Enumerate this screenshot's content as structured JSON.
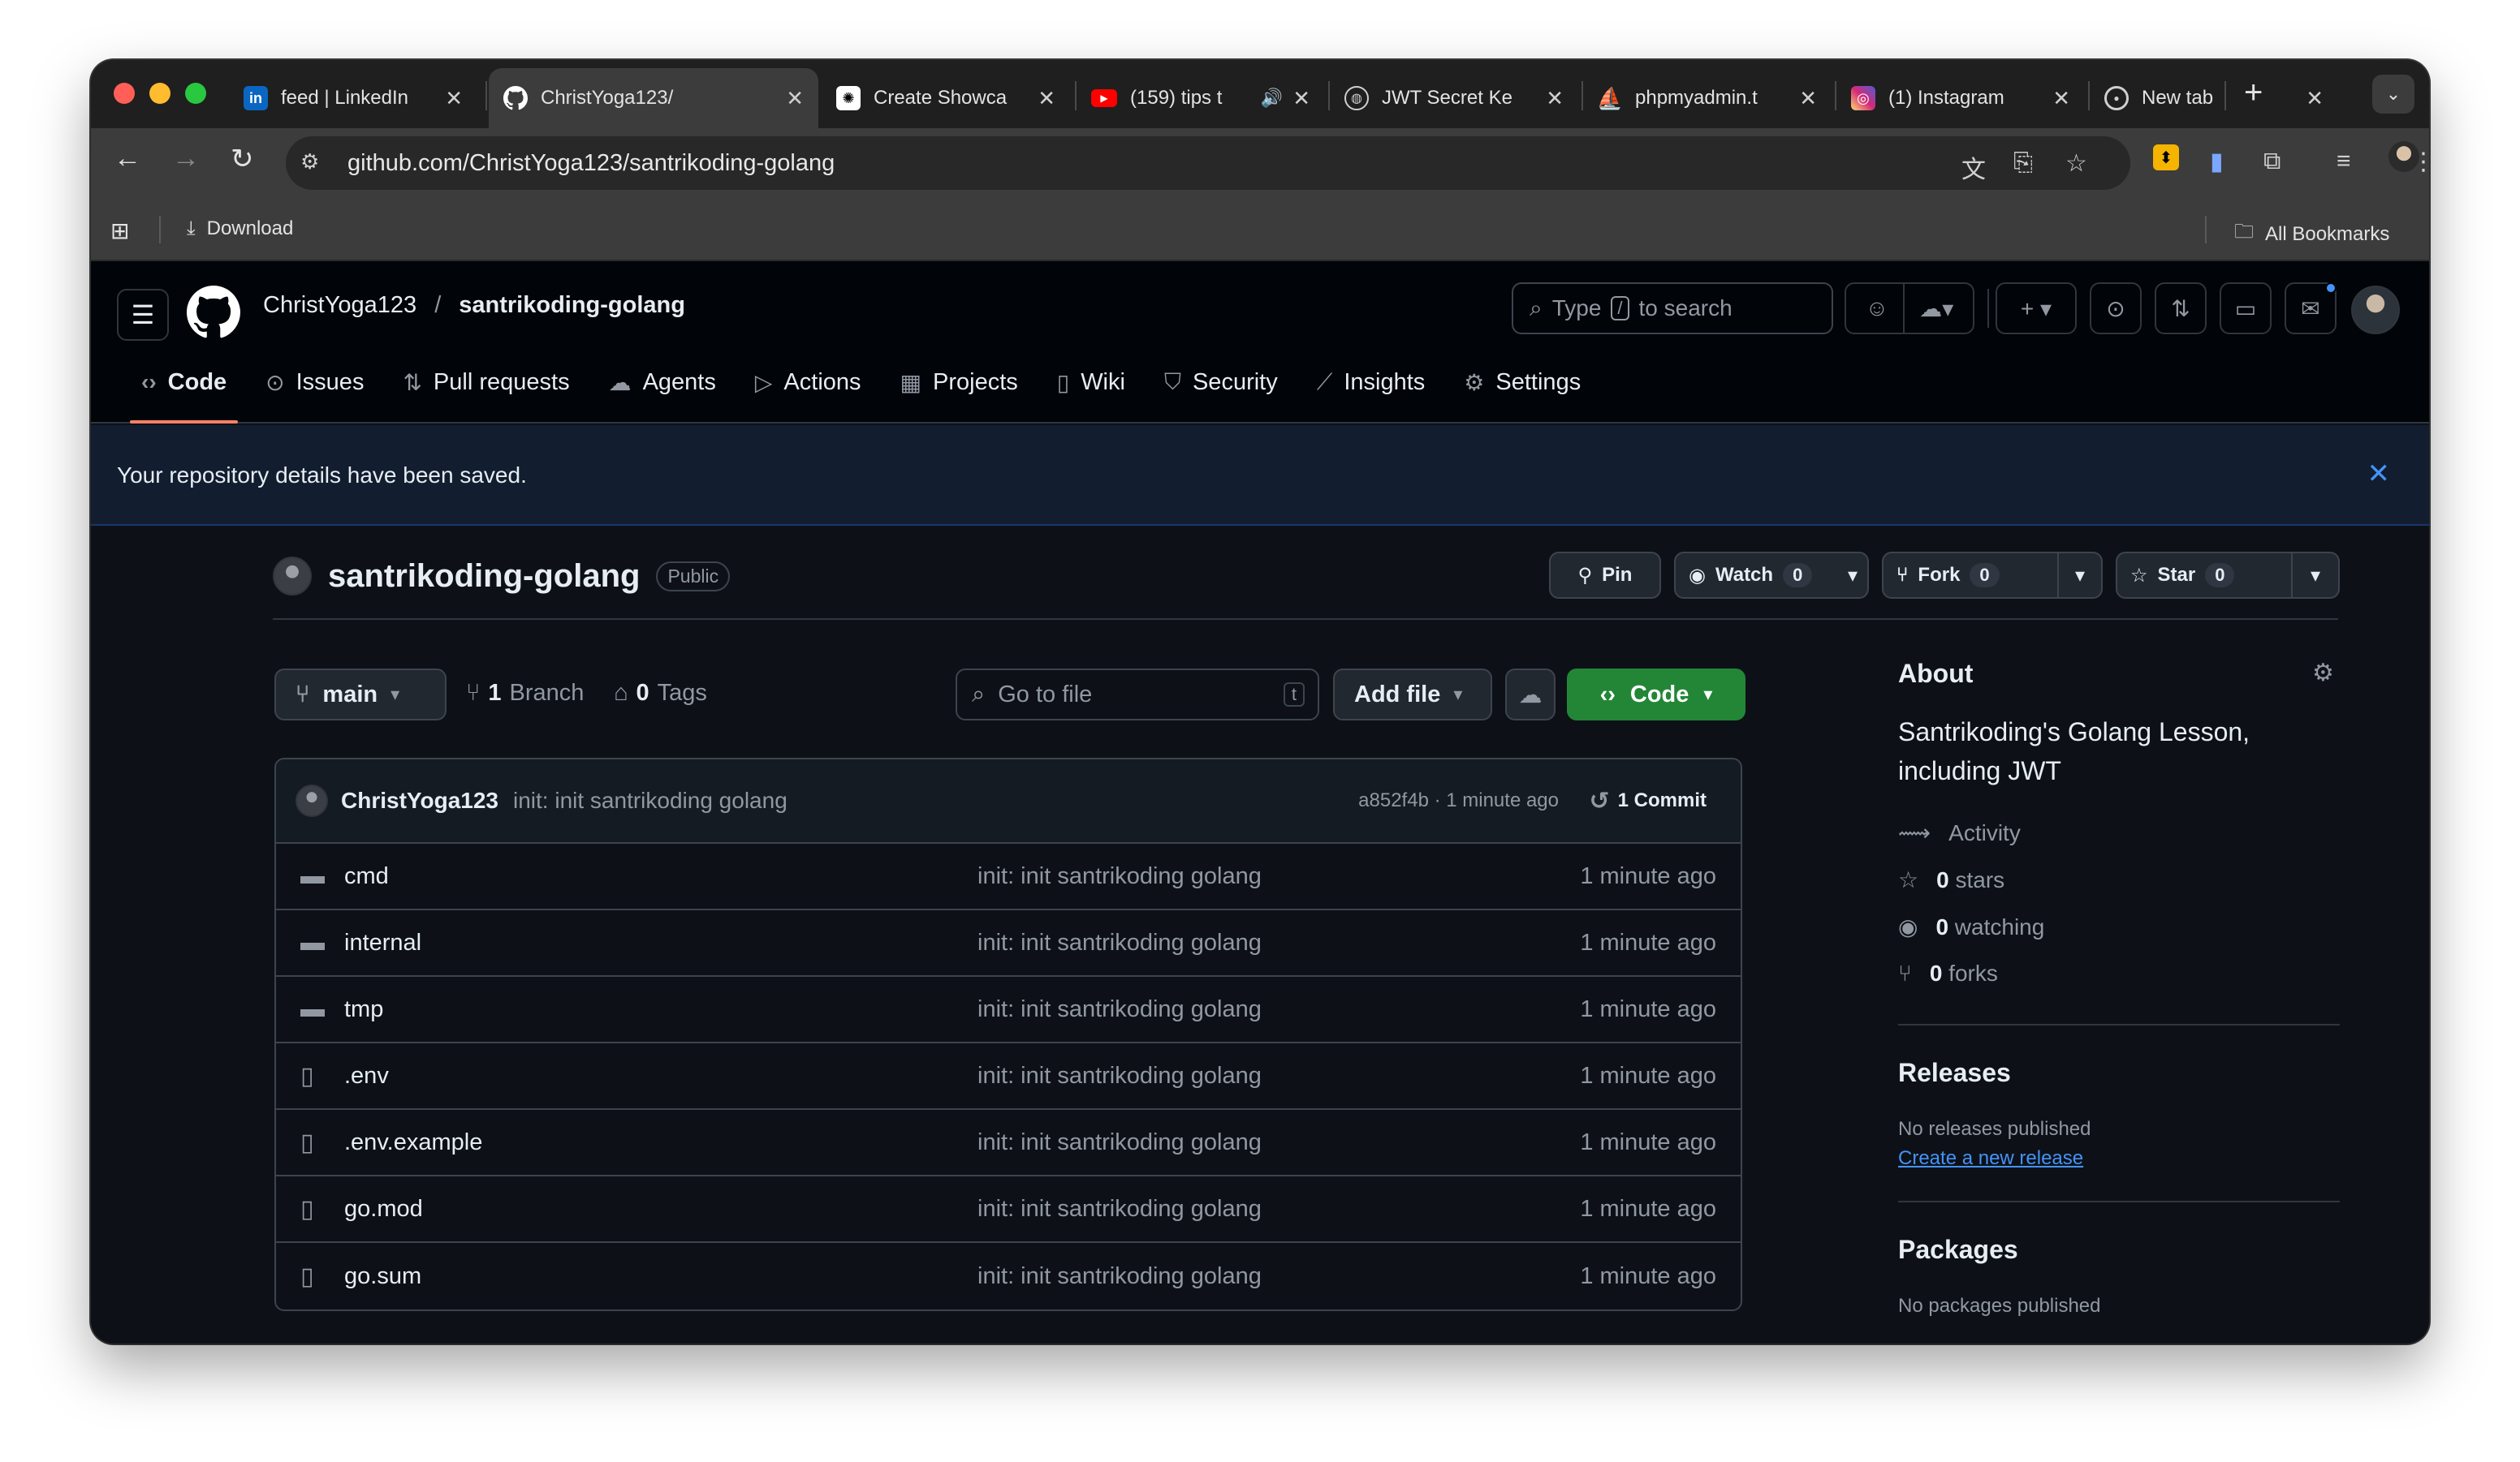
{
  "browser": {
    "tabs": [
      {
        "title": "feed | LinkedIn",
        "icon": "linkedin-icon",
        "active": false
      },
      {
        "title": "ChristYoga123/",
        "icon": "github-icon",
        "active": true
      },
      {
        "title": "Create Showca",
        "icon": "chatgpt-icon",
        "active": false
      },
      {
        "title": "(159) tips t",
        "icon": "youtube-icon",
        "active": false
      },
      {
        "title": "JWT Secret Ke",
        "icon": "globe-icon",
        "active": false
      },
      {
        "title": "phpmyadmin.t",
        "icon": "phpmyadmin-icon",
        "active": false
      },
      {
        "title": "(1) Instagram",
        "icon": "instagram-icon",
        "active": false
      },
      {
        "title": "New tab",
        "icon": "chrome-icon",
        "active": false
      }
    ],
    "url": "github.com/ChristYoga123/santrikoding-golang",
    "bookmarks": {
      "download": "Download",
      "all": "All Bookmarks"
    }
  },
  "header": {
    "owner": "ChristYoga123",
    "separator": "/",
    "repo": "santrikoding-golang",
    "search_prefix": "Type",
    "search_key": "/",
    "search_suffix": "to search"
  },
  "repo_nav": [
    {
      "label": "Code",
      "icon": "code-icon",
      "active": true
    },
    {
      "label": "Issues",
      "icon": "issue-icon",
      "active": false
    },
    {
      "label": "Pull requests",
      "icon": "pull-request-icon",
      "active": false
    },
    {
      "label": "Agents",
      "icon": "agents-icon",
      "active": false
    },
    {
      "label": "Actions",
      "icon": "actions-icon",
      "active": false
    },
    {
      "label": "Projects",
      "icon": "projects-icon",
      "active": false
    },
    {
      "label": "Wiki",
      "icon": "wiki-icon",
      "active": false
    },
    {
      "label": "Security",
      "icon": "shield-icon",
      "active": false
    },
    {
      "label": "Insights",
      "icon": "graph-icon",
      "active": false
    },
    {
      "label": "Settings",
      "icon": "gear-icon",
      "active": false
    }
  ],
  "flash": {
    "message": "Your repository details have been saved."
  },
  "repo": {
    "name": "santrikoding-golang",
    "visibility": "Public",
    "pin": "Pin",
    "watch": "Watch",
    "watch_count": "0",
    "fork": "Fork",
    "fork_count": "0",
    "star": "Star",
    "star_count": "0"
  },
  "controls": {
    "branch": "main",
    "branches_count": "1",
    "branches_label": "Branch",
    "tags_count": "0",
    "tags_label": "Tags",
    "goto_placeholder": "Go to file",
    "goto_key": "t",
    "add_file": "Add file",
    "code": "Code"
  },
  "commit": {
    "author": "ChristYoga123",
    "message": "init: init santrikoding golang",
    "meta": "a852f4b · 1 minute ago",
    "count": "1 Commit"
  },
  "files": [
    {
      "name": "cmd",
      "type": "folder",
      "message": "init: init santrikoding golang",
      "age": "1 minute ago"
    },
    {
      "name": "internal",
      "type": "folder",
      "message": "init: init santrikoding golang",
      "age": "1 minute ago"
    },
    {
      "name": "tmp",
      "type": "folder",
      "message": "init: init santrikoding golang",
      "age": "1 minute ago"
    },
    {
      "name": ".env",
      "type": "file",
      "message": "init: init santrikoding golang",
      "age": "1 minute ago"
    },
    {
      "name": ".env.example",
      "type": "file",
      "message": "init: init santrikoding golang",
      "age": "1 minute ago"
    },
    {
      "name": "go.mod",
      "type": "file",
      "message": "init: init santrikoding golang",
      "age": "1 minute ago"
    },
    {
      "name": "go.sum",
      "type": "file",
      "message": "init: init santrikoding golang",
      "age": "1 minute ago"
    }
  ],
  "about": {
    "title": "About",
    "description": "Santrikoding's Golang Lesson, including JWT",
    "activity": "Activity",
    "stars_count": "0",
    "stars_label": "stars",
    "watching_count": "0",
    "watching_label": "watching",
    "forks_count": "0",
    "forks_label": "forks"
  },
  "releases": {
    "title": "Releases",
    "empty": "No releases published",
    "create_link": "Create a new release"
  },
  "packages": {
    "title": "Packages",
    "empty": "No packages published"
  },
  "colors": {
    "accent_green": "#238636",
    "link_blue": "#4493f8",
    "underline_active": "#f78166",
    "background": "#0d1117"
  }
}
